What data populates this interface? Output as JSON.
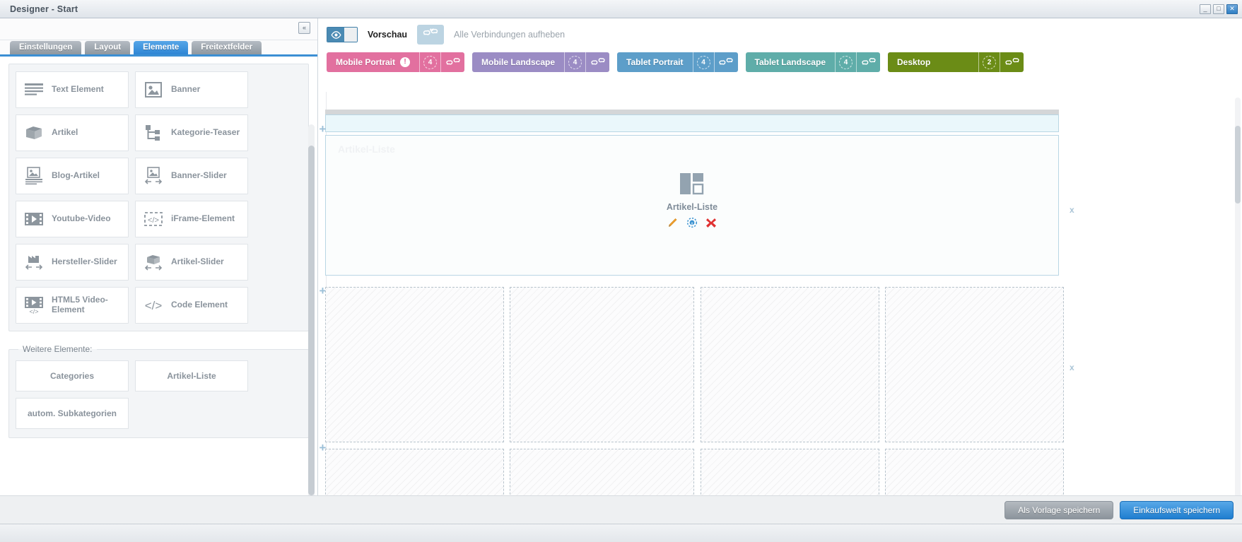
{
  "window": {
    "title": "Designer - Start",
    "buttons": [
      {
        "name": "minimize",
        "glyph": "_"
      },
      {
        "name": "maximize",
        "glyph": "□"
      },
      {
        "name": "close",
        "glyph": "✕"
      }
    ]
  },
  "left_panel": {
    "collapse_label": "«",
    "tabs": [
      {
        "label": "Einstellungen",
        "active": false
      },
      {
        "label": "Layout",
        "active": false
      },
      {
        "label": "Elemente",
        "active": true
      },
      {
        "label": "Freitextfelder",
        "active": false
      }
    ],
    "elements": [
      {
        "label": "Text Element",
        "icon": "text-lines-icon"
      },
      {
        "label": "Banner",
        "icon": "image-icon"
      },
      {
        "label": "Artikel",
        "icon": "box-icon"
      },
      {
        "label": "Kategorie-Teaser",
        "icon": "tree-icon"
      },
      {
        "label": "Blog-Artikel",
        "icon": "image-text-icon"
      },
      {
        "label": "Banner-Slider",
        "icon": "image-arrows-icon"
      },
      {
        "label": "Youtube-Video",
        "icon": "film-play-icon"
      },
      {
        "label": "iFrame-Element",
        "icon": "code-dashed-icon"
      },
      {
        "label": "Hersteller-Slider",
        "icon": "factory-arrows-icon"
      },
      {
        "label": "Artikel-Slider",
        "icon": "box-arrows-icon"
      },
      {
        "label": "HTML5 Video-Element",
        "icon": "film-code-icon"
      },
      {
        "label": "Code Element",
        "icon": "code-icon"
      }
    ],
    "further": {
      "legend": "Weitere Elemente:",
      "items": [
        {
          "label": "Categories"
        },
        {
          "label": "Artikel-Liste"
        },
        {
          "label": "autom. Subkategorien"
        }
      ]
    }
  },
  "toolbar": {
    "preview_label": "Vorschau",
    "preview_enabled": true,
    "unlink_label": "Alle Verbindungen aufheben",
    "unlink_icon": "break-link-icon"
  },
  "device_tabs": [
    {
      "label": "Mobile Portrait",
      "count": "4",
      "color": "#e2709f",
      "warning": true,
      "active": false,
      "link_icon": "link-icon"
    },
    {
      "label": "Mobile Landscape",
      "count": "4",
      "color": "#9b8cc4",
      "warning": false,
      "active": false,
      "link_icon": "link-icon"
    },
    {
      "label": "Tablet Portrait",
      "count": "4",
      "color": "#5d9ec9",
      "warning": false,
      "active": false,
      "link_icon": "link-icon"
    },
    {
      "label": "Tablet Landscape",
      "count": "4",
      "color": "#5fada9",
      "warning": false,
      "active": false,
      "link_icon": "link-icon"
    },
    {
      "label": "Desktop",
      "count": "2",
      "color": "#6b8c16",
      "warning": false,
      "active": true,
      "link_icon": "link-icon"
    }
  ],
  "canvas": {
    "watermark": "Artikel-Liste",
    "element": {
      "name": "Artikel-Liste",
      "icon": "article-list-layout-icon",
      "actions": [
        {
          "name": "edit-element",
          "icon": "pencil-icon",
          "color": "#f0a030"
        },
        {
          "name": "element-settings",
          "icon": "gear-icon",
          "color": "#3a92d0"
        },
        {
          "name": "delete-element",
          "icon": "close-x-icon",
          "color": "#e03131"
        }
      ]
    },
    "add_handle": "+",
    "remove_handle": "x"
  },
  "footer": {
    "save_template_label": "Als Vorlage speichern",
    "save_world_label": "Einkaufswelt speichern"
  }
}
